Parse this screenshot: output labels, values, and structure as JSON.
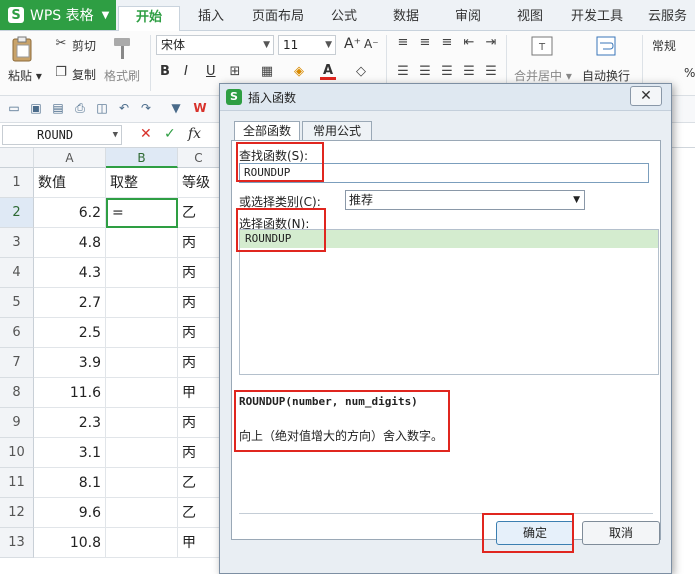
{
  "app": {
    "logo_letter": "S",
    "title": "WPS 表格"
  },
  "tabs": [
    "开始",
    "插入",
    "页面布局",
    "公式",
    "数据",
    "审阅",
    "视图",
    "开发工具",
    "云服务"
  ],
  "ribbon": {
    "paste": "粘贴",
    "cut": "剪切",
    "copy": "复制",
    "format_painter": "格式刷",
    "font_name": "宋体",
    "font_size": "11",
    "bold": "B",
    "italic": "I",
    "underline": "U",
    "font_color_glyph": "A",
    "grow_font": "A⁺",
    "shrink_font": "A⁻",
    "merge_center": "合并居中",
    "wrap_text": "自动换行",
    "number_format": "常规",
    "percent": "%"
  },
  "formula_bar": {
    "name_box": "ROUND",
    "cancel": "✕",
    "confirm": "✓",
    "fx": "fx"
  },
  "sheet": {
    "columns": [
      "A",
      "B",
      "C"
    ],
    "rows": [
      {
        "n": "1",
        "a": "数值",
        "b": "取整",
        "c": "等级"
      },
      {
        "n": "2",
        "a": "6.2",
        "b": "=",
        "c": "乙"
      },
      {
        "n": "3",
        "a": "4.8",
        "b": "",
        "c": "丙"
      },
      {
        "n": "4",
        "a": "4.3",
        "b": "",
        "c": "丙"
      },
      {
        "n": "5",
        "a": "2.7",
        "b": "",
        "c": "丙"
      },
      {
        "n": "6",
        "a": "2.5",
        "b": "",
        "c": "丙"
      },
      {
        "n": "7",
        "a": "3.9",
        "b": "",
        "c": "丙"
      },
      {
        "n": "8",
        "a": "11.6",
        "b": "",
        "c": "甲"
      },
      {
        "n": "9",
        "a": "2.3",
        "b": "",
        "c": "丙"
      },
      {
        "n": "10",
        "a": "3.1",
        "b": "",
        "c": "丙"
      },
      {
        "n": "11",
        "a": "8.1",
        "b": "",
        "c": "乙"
      },
      {
        "n": "12",
        "a": "9.6",
        "b": "",
        "c": "乙"
      },
      {
        "n": "13",
        "a": "10.8",
        "b": "",
        "c": "甲"
      }
    ]
  },
  "dialog": {
    "title": "插入函数",
    "close": "✕",
    "tab_all": "全部函数",
    "tab_common": "常用公式",
    "search_label": "查找函数(S):",
    "search_value": "ROUNDUP",
    "category_label": "或选择类别(C):",
    "category_value": "推荐",
    "function_label": "选择函数(N):",
    "functions": [
      "ROUNDUP"
    ],
    "signature": "ROUNDUP(number, num_digits)",
    "description": "向上（绝对值增大的方向）舍入数字。",
    "ok": "确定",
    "cancel": "取消"
  },
  "colors": {
    "brand": "#2e9e43",
    "highlight": "#e0261f",
    "selected_item": "#d4eccf"
  }
}
